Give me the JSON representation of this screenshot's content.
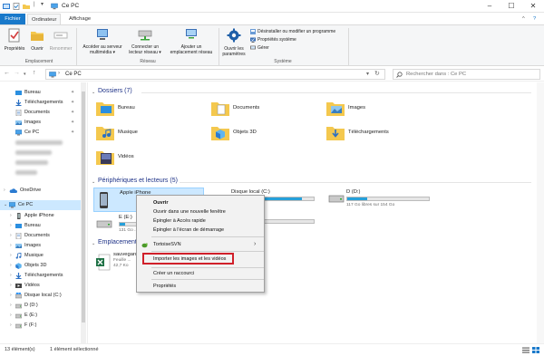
{
  "window": {
    "title": "Ce PC",
    "controls": {
      "minimize": "–",
      "maximize": "☐",
      "close": "✕"
    }
  },
  "ribbon_tabs": [
    "Fichier",
    "Ordinateur",
    "Affichage"
  ],
  "ribbon": {
    "groups": {
      "location": {
        "label": "Emplacement",
        "buttons": [
          "Propriétés",
          "Ouvrir",
          "Renommer"
        ]
      },
      "network": {
        "label": "Réseau",
        "buttons": [
          {
            "line1": "Accéder au serveur",
            "line2": "multimédia ▾"
          },
          {
            "line1": "Connecter un",
            "line2": "lecteur réseau ▾"
          },
          {
            "line1": "Ajouter un",
            "line2": "emplacement réseau"
          }
        ]
      },
      "system": {
        "label": "Système",
        "open_settings": {
          "line1": "Ouvrir les",
          "line2": "paramètres"
        },
        "small_buttons": [
          "Désinstaller ou modifier un programme",
          "Propriétés système",
          "Gérer"
        ]
      }
    },
    "collapse_icon": "^",
    "help_icon": "?"
  },
  "address": {
    "path": "Ce PC",
    "search_placeholder": "Rechercher dans : Ce PC"
  },
  "sidebar": {
    "quick_access": [
      {
        "label": "Bureau",
        "pinned": true
      },
      {
        "label": "Téléchargements",
        "pinned": true
      },
      {
        "label": "Documents",
        "pinned": true
      },
      {
        "label": "Images",
        "pinned": true
      },
      {
        "label": "Ce PC",
        "pinned": true
      }
    ],
    "onedrive": "OneDrive",
    "this_pc": "Ce PC",
    "this_pc_items": [
      "Apple iPhone",
      "Bureau",
      "Documents",
      "Images",
      "Musique",
      "Objets 3D",
      "Téléchargements",
      "Vidéos",
      "Disque local (C:)",
      "D (D:)",
      "E (E:)",
      "F (F:)"
    ],
    "pin_glyph": "📌"
  },
  "main": {
    "folders_header": "Dossiers (7)",
    "folders": [
      "Bureau",
      "Documents",
      "Images",
      "Musique",
      "Objets 3D",
      "Téléchargements",
      "Vidéos"
    ],
    "devices_header": "Périphériques et lecteurs (5)",
    "devices": [
      {
        "name": "Apple iPhone",
        "space": ""
      },
      {
        "name": "Disque local (C:)",
        "space": "... sur 223 Go",
        "fill": 0.85
      },
      {
        "name": "D (D:)",
        "space": "117 Go libres sur 154 Go",
        "fill": 0.24
      },
      {
        "name": "E (E:)",
        "space": "131 Go ...",
        "fill": 0.3
      },
      {
        "name": "",
        "space": "... sur 155 Go",
        "fill": 0.22
      }
    ],
    "network_header": "Emplacements réseau",
    "network_item": {
      "name": "sauvegarde",
      "line2": "Feuille ...",
      "line3": "42,7 Ko"
    }
  },
  "context_menu": {
    "items": [
      "Ouvrir",
      "Ouvrir dans une nouvelle fenêtre",
      "Épingler à Accès rapide",
      "Épingler à l'écran de démarrage",
      "TortoiseSVN",
      "Importer les images et les vidéos",
      "Créer un raccourci",
      "Propriétés"
    ],
    "submenu_arrow": "›"
  },
  "status": {
    "count": "13 élément(s)",
    "selected": "1 élément sélectionné"
  },
  "colors": {
    "accent": "#1979ca",
    "selection": "#cce8ff",
    "drive_fill": "#26a0da",
    "highlight_box": "#d0202a",
    "folder": "#f4c84e"
  }
}
